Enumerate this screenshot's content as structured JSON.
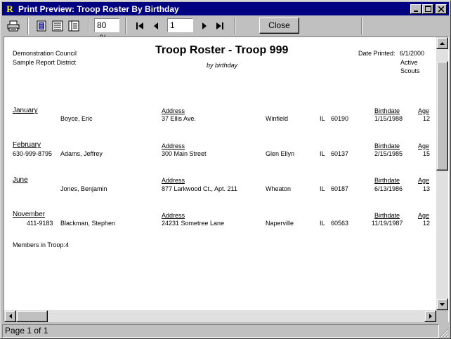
{
  "window": {
    "title": "Print Preview: Troop Roster By Birthday",
    "app_icon_letter": "R",
    "controls": {
      "minimize": "_",
      "maximize": "□",
      "close": "×"
    }
  },
  "toolbar": {
    "icons": [
      "printer-icon",
      "single-page-icon",
      "multi-page-icon",
      "tree-view-icon"
    ],
    "zoom_value": "80",
    "zoom_unit": "%",
    "page_value": "1",
    "close_label": "Close"
  },
  "report": {
    "council": "Demonstration Council",
    "district": "Sample Report District",
    "title": "Troop Roster - Troop 999",
    "subtitle": "by birthday",
    "date_printed_label": "Date Printed:",
    "date_printed": "6/1/2000",
    "status_line1": "Active",
    "status_line2": "Scouts",
    "address_header": "Address",
    "birthdate_header": "Birthdate",
    "age_header": "Age",
    "groups": [
      {
        "month": "January",
        "phone": "",
        "name": "Boyce, Eric",
        "address": "37 Ellis Ave.",
        "city": "Winfield",
        "state": "IL",
        "zip": "60190",
        "birthdate": "1/15/1988",
        "age": "12"
      },
      {
        "month": "February",
        "phone": "630-999-8795",
        "name": "Adams, Jeffrey",
        "address": "300 Main Street",
        "city": "Glen Ellyn",
        "state": "IL",
        "zip": "60137",
        "birthdate": "2/15/1985",
        "age": "15"
      },
      {
        "month": "June",
        "phone": "",
        "name": "Jones, Benjamin",
        "address": "877 Larkwood Ct., Apt. 211",
        "city": "Wheaton",
        "state": "IL",
        "zip": "60187",
        "birthdate": "6/13/1986",
        "age": "13"
      },
      {
        "month": "November",
        "phone": "411-9183",
        "name": "Blackman, Stephen",
        "address": "24231 Sometree Lane",
        "city": "Naperville",
        "state": "IL",
        "zip": "60563",
        "birthdate": "11/19/1987",
        "age": "12"
      }
    ],
    "members_label": "Members in Troop:",
    "members_count": "4"
  },
  "status": {
    "page_text": "Page 1 of 1"
  }
}
